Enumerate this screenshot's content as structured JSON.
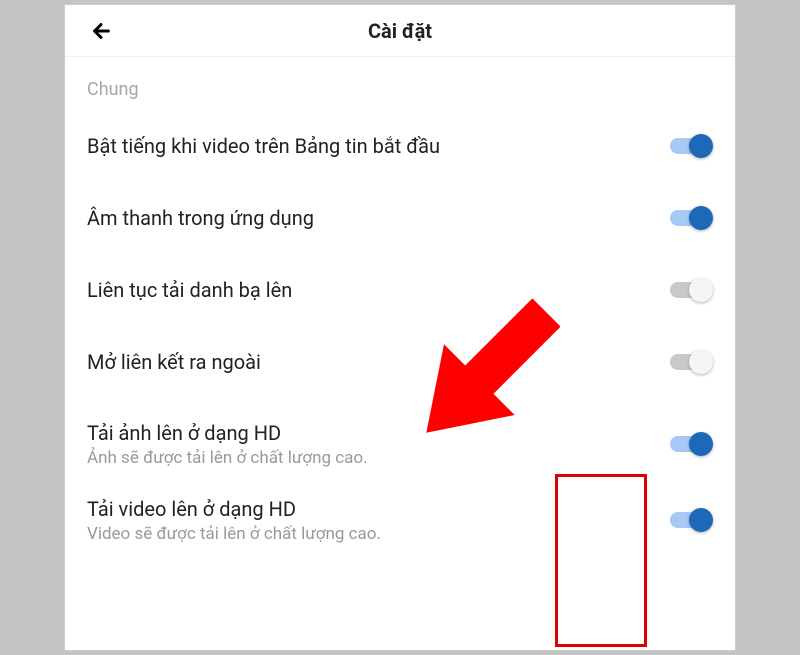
{
  "header": {
    "title": "Cài đặt"
  },
  "section_label": "Chung",
  "rows": [
    {
      "label": "Bật tiếng khi video trên Bảng tin bắt đầu",
      "sub": "",
      "on": true
    },
    {
      "label": "Âm thanh trong ứng dụng",
      "sub": "",
      "on": true
    },
    {
      "label": "Liên tục tải danh bạ lên",
      "sub": "",
      "on": false
    },
    {
      "label": "Mở liên kết ra ngoài",
      "sub": "",
      "on": false
    },
    {
      "label": "Tải ảnh lên ở dạng HD",
      "sub": "Ảnh sẽ được tải lên ở chất lượng cao.",
      "on": true
    },
    {
      "label": "Tải video lên ở dạng HD",
      "sub": "Video sẽ được tải lên ở chất lượng cao.",
      "on": true
    }
  ]
}
